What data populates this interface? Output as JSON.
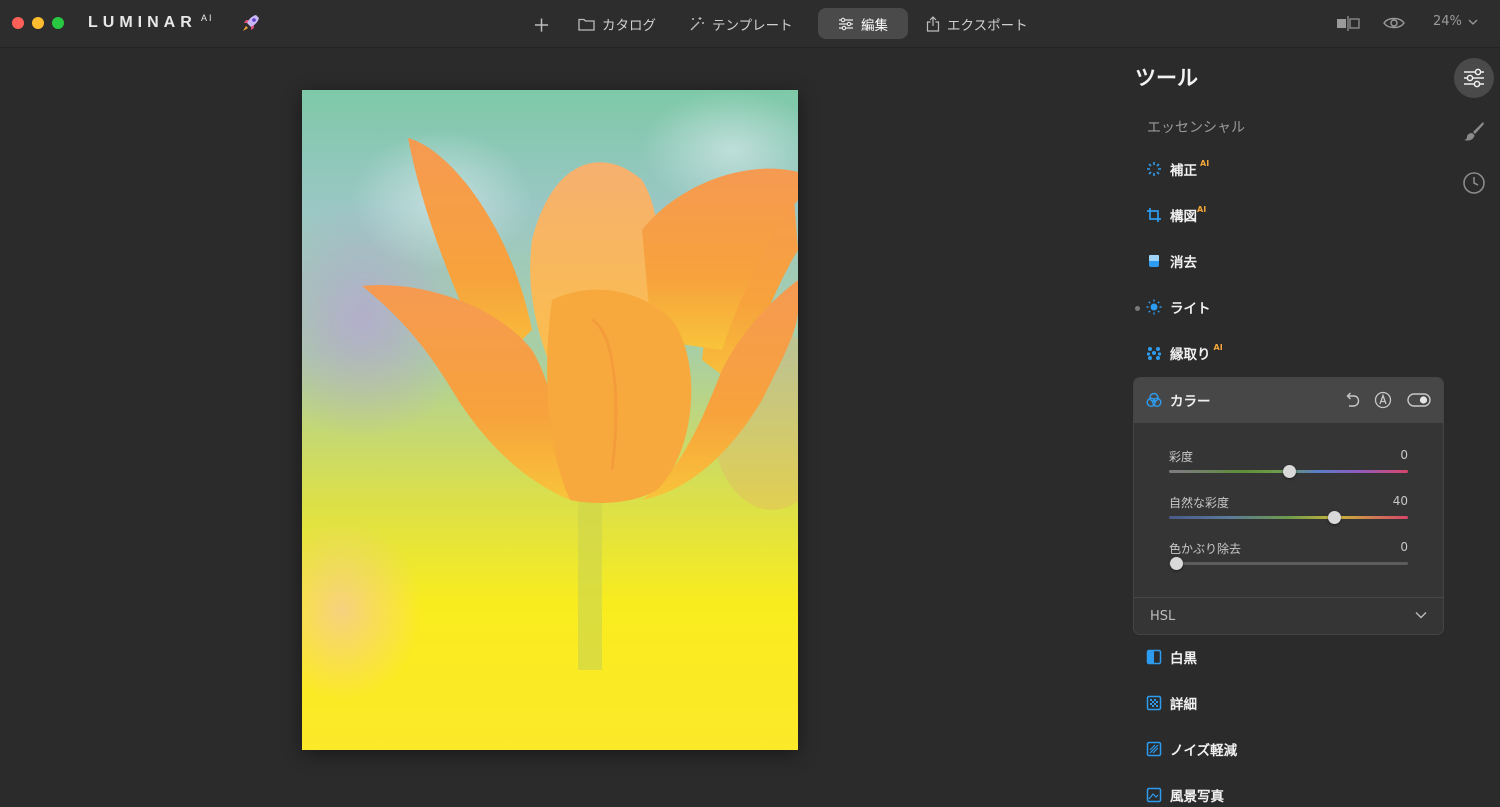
{
  "window": {
    "app_name": "LUMINAR",
    "app_suffix": "AI"
  },
  "topbar": {
    "nav": {
      "catalog": "カタログ",
      "templates": "テンプレート",
      "edit": "編集",
      "export": "エクスポート"
    },
    "zoom": "24%"
  },
  "panel": {
    "title": "ツール",
    "section": "エッセンシャル",
    "ai_badge": "AI",
    "tools_top": [
      {
        "label": "補正",
        "ai": true,
        "icon": "magic-wand-icon"
      },
      {
        "label": "構図",
        "ai": true,
        "icon": "crop-icon"
      },
      {
        "label": "消去",
        "ai": false,
        "icon": "eraser-icon"
      },
      {
        "label": "ライト",
        "ai": false,
        "icon": "sun-icon"
      },
      {
        "label": "縁取り",
        "ai": true,
        "icon": "dots-icon"
      }
    ],
    "color_tool": {
      "label": "カラー",
      "sliders": [
        {
          "label": "彩度",
          "value": "0",
          "position": 0.5
        },
        {
          "label": "自然な彩度",
          "value": "40",
          "position": 0.69
        },
        {
          "label": "色かぶり除去",
          "value": "0",
          "position": 0.03
        }
      ],
      "hsl_label": "HSL"
    },
    "tools_bottom": [
      {
        "label": "白黒",
        "icon": "bw-icon"
      },
      {
        "label": "詳細",
        "icon": "detail-icon"
      },
      {
        "label": "ノイズ軽減",
        "icon": "noise-icon"
      },
      {
        "label": "風景写真",
        "icon": "landscape-icon"
      }
    ]
  },
  "colors": {
    "accent_blue": "#2d9cf0",
    "ai_orange": "#f3a63a",
    "background": "#2b2b2b"
  }
}
